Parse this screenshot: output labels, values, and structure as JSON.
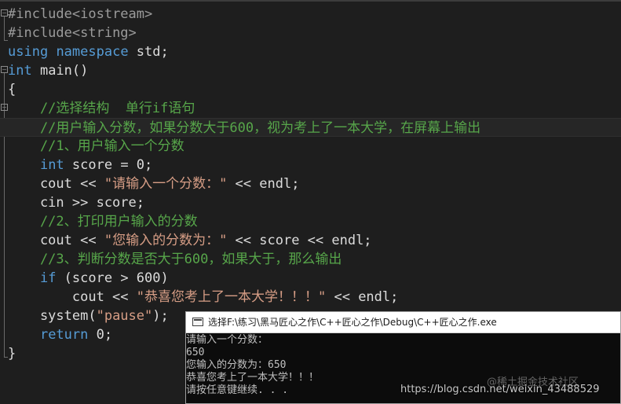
{
  "editor": {
    "lines": [
      {
        "parts": [
          {
            "t": "#include",
            "c": "pp"
          },
          {
            "t": "<iostream>",
            "c": "pp"
          }
        ]
      },
      {
        "parts": [
          {
            "t": "#include",
            "c": "pp"
          },
          {
            "t": "<string>",
            "c": "pp"
          }
        ]
      },
      {
        "parts": [
          {
            "t": "using",
            "c": "kw"
          },
          {
            "t": " ",
            "c": "pl"
          },
          {
            "t": "namespace",
            "c": "kw"
          },
          {
            "t": " std;",
            "c": "pl"
          }
        ]
      },
      {
        "parts": [
          {
            "t": "int",
            "c": "kw"
          },
          {
            "t": " main()",
            "c": "pl"
          }
        ]
      },
      {
        "parts": [
          {
            "t": "{",
            "c": "pl"
          }
        ]
      },
      {
        "parts": [
          {
            "t": "    //选择结构  单行if语句",
            "c": "cm"
          }
        ]
      },
      {
        "parts": [
          {
            "t": "    //用户输入分数，如果分数大于600，视为考上了一本大学，在屏幕上输出",
            "c": "cm"
          }
        ],
        "current": true
      },
      {
        "parts": [
          {
            "t": "    //1、用户输入一个分数",
            "c": "cm"
          }
        ]
      },
      {
        "parts": [
          {
            "t": "    ",
            "c": "pl"
          },
          {
            "t": "int",
            "c": "kw"
          },
          {
            "t": " score = 0;",
            "c": "pl"
          }
        ]
      },
      {
        "parts": [
          {
            "t": "    cout << ",
            "c": "pl"
          },
          {
            "t": "\"请输入一个分数：\"",
            "c": "st"
          },
          {
            "t": " << endl;",
            "c": "pl"
          }
        ]
      },
      {
        "parts": [
          {
            "t": "    cin >> score;",
            "c": "pl"
          }
        ]
      },
      {
        "parts": [
          {
            "t": "    //2、打印用户输入的分数",
            "c": "cm"
          }
        ]
      },
      {
        "parts": [
          {
            "t": "    cout << ",
            "c": "pl"
          },
          {
            "t": "\"您输入的分数为：\"",
            "c": "st"
          },
          {
            "t": " << score << endl;",
            "c": "pl"
          }
        ]
      },
      {
        "parts": [
          {
            "t": "    //3、判断分数是否大于600，如果大于，那么输出",
            "c": "cm"
          }
        ]
      },
      {
        "parts": [
          {
            "t": "    ",
            "c": "pl"
          },
          {
            "t": "if",
            "c": "kw"
          },
          {
            "t": " (score > 600)",
            "c": "pl"
          }
        ]
      },
      {
        "parts": [
          {
            "t": "        cout << ",
            "c": "pl"
          },
          {
            "t": "\"恭喜您考上了一本大学！！！\"",
            "c": "st"
          },
          {
            "t": " << endl;",
            "c": "pl"
          }
        ]
      },
      {
        "parts": [
          {
            "t": "    system(",
            "c": "pl"
          },
          {
            "t": "\"pause\"",
            "c": "st"
          },
          {
            "t": ");",
            "c": "pl"
          }
        ]
      },
      {
        "parts": [
          {
            "t": "    ",
            "c": "pl"
          },
          {
            "t": "return",
            "c": "kw"
          },
          {
            "t": " 0;",
            "c": "pl"
          }
        ]
      },
      {
        "parts": [
          {
            "t": "}",
            "c": "pl"
          }
        ]
      }
    ]
  },
  "console": {
    "title": "选择F:\\练习\\黑马匠心之作\\C++匠心之作\\Debug\\C++匠心之作.exe",
    "lines": [
      "请输入一个分数：",
      "650",
      "您输入的分数为：650",
      "恭喜您考上了一本大学！！！",
      "请按任意键继续. . ."
    ]
  },
  "watermark": {
    "url": "https://blog.csdn.net/weixin_43488529",
    "brand": "@稀土掘金技术社区"
  },
  "colors": {
    "background": "#1e1e1e",
    "keyword": "#569cd6",
    "comment": "#57a64a",
    "string": "#d69d85",
    "preprocessor": "#9b9b9b",
    "console_bg": "#0c0c0c"
  }
}
